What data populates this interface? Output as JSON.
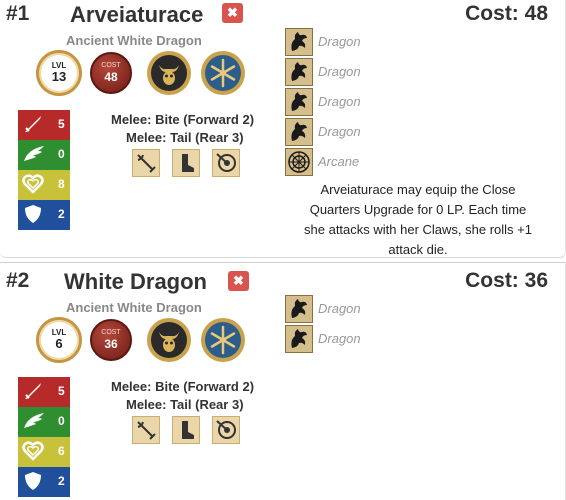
{
  "cards": [
    {
      "number": "#1",
      "name": "Arveiaturace",
      "remove_label": "✖",
      "cost_label": "Cost: 48",
      "subtitle": "Ancient White Dragon",
      "level": {
        "label": "LVL",
        "value": "13"
      },
      "cost_badge": {
        "label": "COST",
        "value": "48"
      },
      "stats": [
        {
          "icon": "sword-icon",
          "value": "5",
          "color": "#b62a2a"
        },
        {
          "icon": "wing-icon",
          "value": "0",
          "color": "#2f8e2f"
        },
        {
          "icon": "heart-icon",
          "value": "8",
          "color": "#c7c23a"
        },
        {
          "icon": "shield-icon",
          "value": "2",
          "color": "#204f9c"
        }
      ],
      "attacks": [
        "Melee: Bite (Forward 2)",
        "Melee: Tail (Rear 3)"
      ],
      "traits": [
        "Dragon",
        "Dragon",
        "Dragon",
        "Dragon",
        "Arcane"
      ],
      "description": "Arveiaturace may equip the Close Quarters Upgrade for 0 LP. Each time she attacks with her Claws, she rolls +1 attack die."
    },
    {
      "number": "#2",
      "name": "White Dragon",
      "remove_label": "✖",
      "cost_label": "Cost: 36",
      "subtitle": "Ancient White Dragon",
      "level": {
        "label": "LVL",
        "value": "6"
      },
      "cost_badge": {
        "label": "COST",
        "value": "36"
      },
      "stats": [
        {
          "icon": "sword-icon",
          "value": "5",
          "color": "#b62a2a"
        },
        {
          "icon": "wing-icon",
          "value": "0",
          "color": "#2f8e2f"
        },
        {
          "icon": "heart-icon",
          "value": "6",
          "color": "#c7c23a"
        },
        {
          "icon": "shield-icon",
          "value": "2",
          "color": "#204f9c"
        }
      ],
      "attacks": [
        "Melee: Bite (Forward 2)",
        "Melee: Tail (Rear 3)"
      ],
      "traits": [
        "Dragon",
        "Dragon"
      ]
    }
  ]
}
